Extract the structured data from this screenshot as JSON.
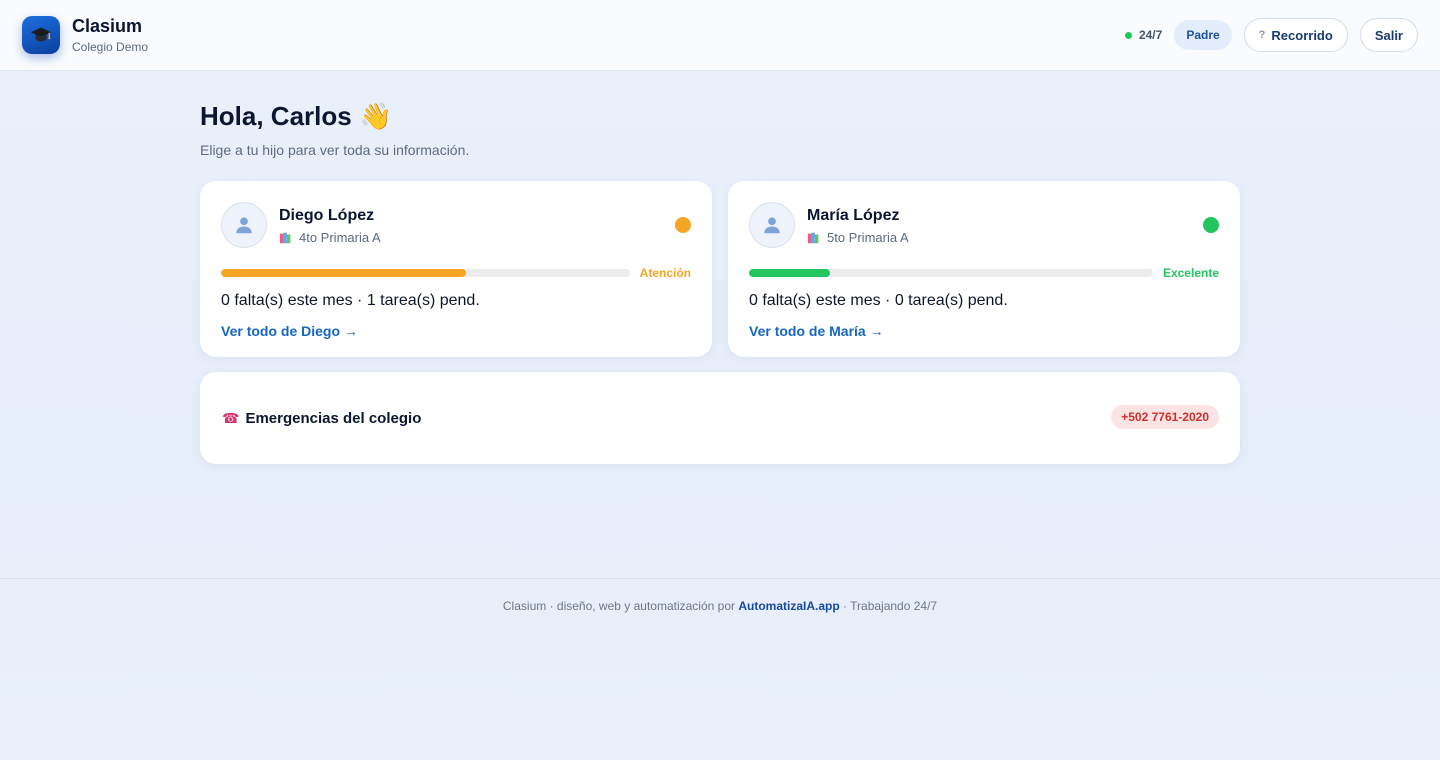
{
  "header": {
    "app_name": "Clasium",
    "school": "Colegio Demo",
    "status_text": "24/7",
    "role": "Padre",
    "tour_label": "Recorrido",
    "tour_icon": "?",
    "logout_label": "Salir"
  },
  "greeting": {
    "title": "Hola, Carlos",
    "emoji": "👋",
    "subtitle": "Elige a tu hijo para ver toda su información."
  },
  "children": [
    {
      "name": "Diego López",
      "grade": "4to Primaria A",
      "status_label": "Atención",
      "status_color": "#f5a524",
      "progress": 0.6,
      "stats": "0 falta(s) este mes · 1 tarea(s) pend.",
      "link": "Ver todo de Diego →"
    },
    {
      "name": "María López",
      "grade": "5to Primaria A",
      "status_label": "Excelente",
      "status_color": "#22c55e",
      "progress": 0.2,
      "stats": "0 falta(s) este mes · 0 tarea(s) pend.",
      "link": "Ver todo de María →"
    }
  ],
  "emergency": {
    "icon": "☎",
    "title": "Emergencias del colegio",
    "phone": "+502 7761-2020"
  },
  "footer": {
    "prefix": "Clasium · diseño, web y automatización por ",
    "brand": "AutomatizaIA.app",
    "suffix": " · Trabajando 24/7"
  },
  "colors": {
    "accent": "#1665c0",
    "warning": "#f5a524",
    "success": "#22c55e",
    "danger": "#d12f2f"
  }
}
